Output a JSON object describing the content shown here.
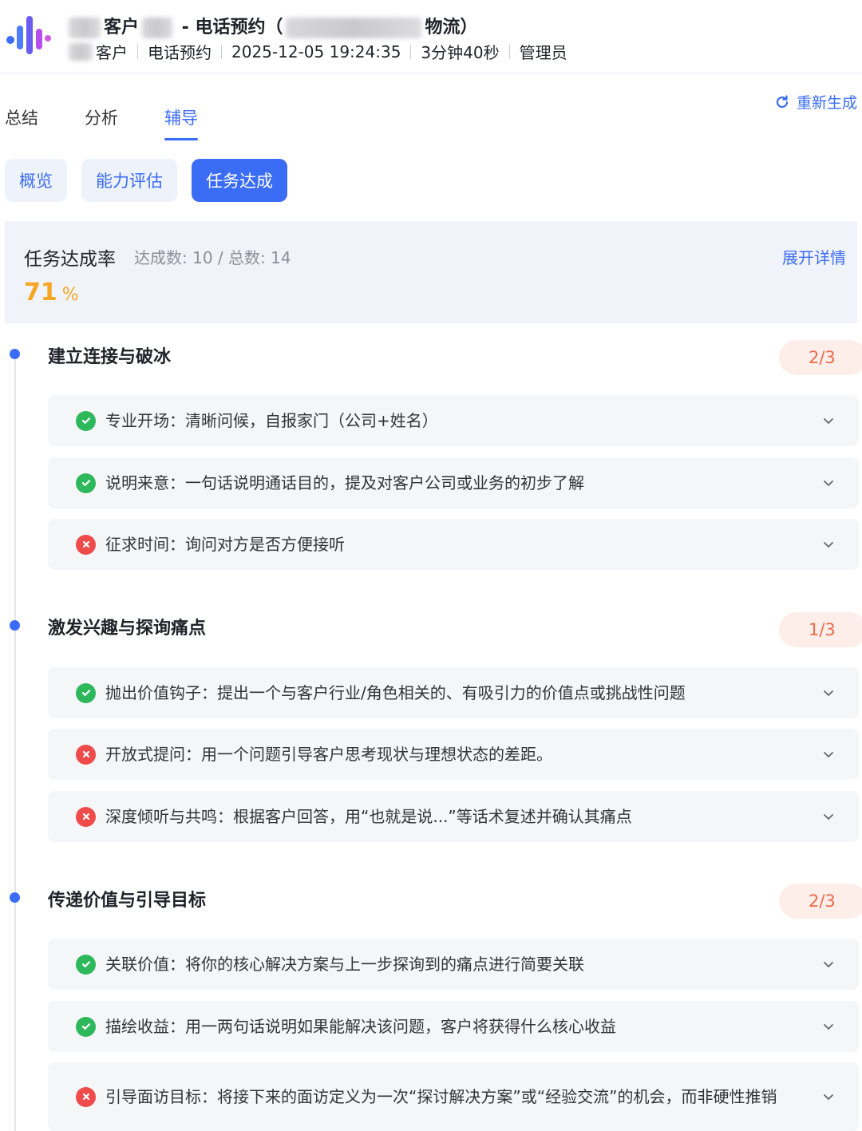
{
  "header": {
    "title_prefix": "客户",
    "title_middle": " - 电话预约（",
    "title_suffix": "物流）",
    "meta_customer": "客户",
    "meta_type": "电话预约",
    "meta_datetime": "2025-12-05 19:24:35",
    "meta_duration": "3分钟40秒",
    "meta_role": "管理员"
  },
  "tabs": [
    {
      "label": "总结",
      "active": false
    },
    {
      "label": "分析",
      "active": false
    },
    {
      "label": "辅导",
      "active": true
    }
  ],
  "regenerate_label": "重新生成",
  "subtabs": [
    {
      "label": "概览",
      "active": false
    },
    {
      "label": "能力评估",
      "active": false
    },
    {
      "label": "任务达成",
      "active": true
    }
  ],
  "summary": {
    "label": "任务达成率",
    "counts": "达成数: 10 / 总数: 14",
    "rate": "71",
    "unit": "%",
    "expand_label": "展开详情"
  },
  "sections": [
    {
      "title": "建立连接与破冰",
      "score": "2/3",
      "items": [
        {
          "status": "done",
          "text": "专业开场：清晰问候，自报家门（公司+姓名）"
        },
        {
          "status": "done",
          "text": "说明来意：一句话说明通话目的，提及对客户公司或业务的初步了解"
        },
        {
          "status": "fail",
          "text": "征求时间：询问对方是否方便接听"
        }
      ]
    },
    {
      "title": "激发兴趣与探询痛点",
      "score": "1/3",
      "items": [
        {
          "status": "done",
          "text": "抛出价值钩子：提出一个与客户行业/角色相关的、有吸引力的价值点或挑战性问题"
        },
        {
          "status": "fail",
          "text": "开放式提问：用一个问题引导客户思考现状与理想状态的差距。"
        },
        {
          "status": "fail",
          "text": "深度倾听与共鸣：根据客户回答，用“也就是说...”等话术复述并确认其痛点"
        }
      ]
    },
    {
      "title": "传递价值与引导目标",
      "score": "2/3",
      "items": [
        {
          "status": "done",
          "text": "关联价值：将你的核心解决方案与上一步探询到的痛点进行简要关联"
        },
        {
          "status": "done",
          "text": "描绘收益：用一两句话说明如果能解决该问题，客户将获得什么核心收益"
        },
        {
          "status": "fail",
          "text": "引导面访目标：将接下来的面访定义为一次“探讨解决方案”或“经验交流”的机会，而非硬性推销"
        }
      ]
    }
  ]
}
